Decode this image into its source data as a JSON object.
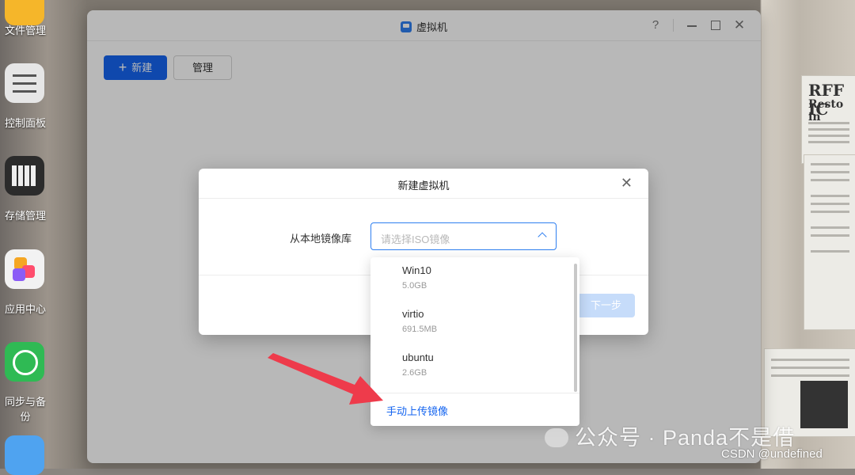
{
  "desktop": {
    "dock": [
      {
        "label": "文件管理",
        "icon": "folder-icon",
        "color": "#f5b62a"
      },
      {
        "label": "控制面板",
        "icon": "sliders-icon",
        "color": "#e8e8e8"
      },
      {
        "label": "存储管理",
        "icon": "storage-icon",
        "color": "#2b2b2b"
      },
      {
        "label": "应用中心",
        "icon": "app-center-icon",
        "color": "#f0f0f0"
      },
      {
        "label": "同步与备份",
        "icon": "sync-icon",
        "color": "#2fba54"
      }
    ],
    "newspaper_text": [
      "RFF IC",
      "Resto in"
    ]
  },
  "window": {
    "title": "虚拟机",
    "help": "?",
    "toolbar": {
      "new_label": "新建",
      "manage_label": "管理"
    }
  },
  "dialog": {
    "title": "新建虚拟机",
    "field_label": "从本地镜像库",
    "select_placeholder": "请选择ISO镜像",
    "next_label": "下一步"
  },
  "dropdown": {
    "options": [
      {
        "name": "Win10",
        "size": "5.0GB"
      },
      {
        "name": "virtio",
        "size": "691.5MB"
      },
      {
        "name": "ubuntu",
        "size": "2.6GB"
      }
    ],
    "upload_label": "手动上传镜像"
  },
  "watermark": {
    "text": "公众号 · Panda不是借",
    "csdn": "CSDN @undefined"
  },
  "colors": {
    "accent": "#1565f0",
    "arrow": "#ee3b4b"
  }
}
